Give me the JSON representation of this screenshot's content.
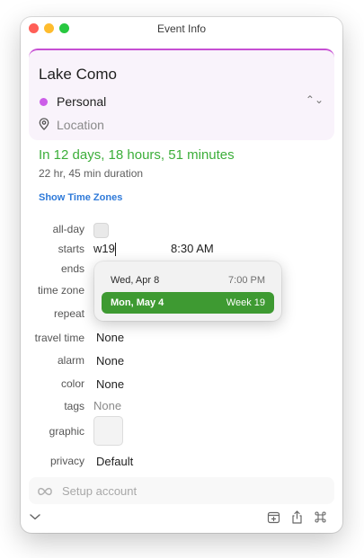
{
  "window": {
    "title": "Event Info",
    "traffic_lights": {
      "close": "#ff5f57",
      "minimize": "#febc2e",
      "zoom": "#28c840"
    }
  },
  "event": {
    "title": "Lake Como",
    "calendar": {
      "name": "Personal",
      "color": "#cc5de8"
    },
    "location_placeholder": "Location",
    "countdown": "In 12 days, 18 hours, 51 minutes",
    "duration": "22 hr, 45 min duration",
    "show_time_zones_label": "Show Time Zones"
  },
  "fields": {
    "all_day": {
      "label": "all-day",
      "checked": false
    },
    "starts": {
      "label": "starts",
      "date_input": "w19",
      "time": "8:30 AM"
    },
    "ends": {
      "label": "ends"
    },
    "time_zone": {
      "label": "time zone"
    },
    "repeat": {
      "label": "repeat"
    },
    "travel_time": {
      "label": "travel time",
      "value": "None"
    },
    "alarm": {
      "label": "alarm",
      "value": "None"
    },
    "color": {
      "label": "color",
      "value": "None"
    },
    "tags": {
      "label": "tags",
      "value": "None"
    },
    "graphic": {
      "label": "graphic"
    },
    "privacy": {
      "label": "privacy",
      "value": "Default"
    }
  },
  "date_suggestions": [
    {
      "date": "Wed, Apr 8",
      "info": "7:00 PM",
      "selected": false
    },
    {
      "date": "Mon, May 4",
      "info": "Week 19",
      "selected": true
    }
  ],
  "setup_account": {
    "label": "Setup account",
    "icon": "infinity-icon"
  },
  "bottom_bar": {
    "icons": [
      "chevron-down-icon",
      "add-to-calendar-icon",
      "share-icon",
      "command-icon"
    ]
  },
  "colors": {
    "accent_green": "#3cae3a",
    "link_blue": "#2f7ad9",
    "selected_suggestion": "#3e9a32"
  }
}
